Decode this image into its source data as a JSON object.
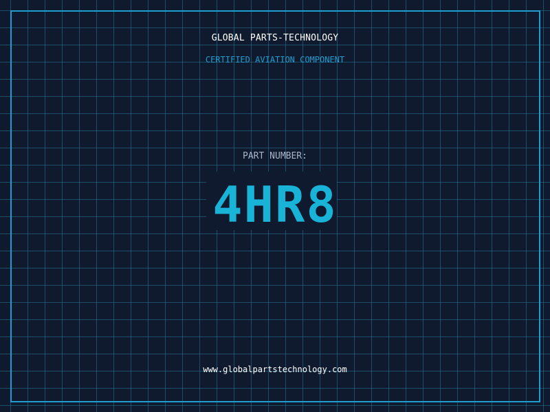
{
  "header": {
    "company_name": "GLOBAL PARTS-TECHNOLOGY",
    "tagline": "CERTIFIED AVIATION COMPONENT"
  },
  "part": {
    "label": "PART NUMBER:",
    "number": "4HR8"
  },
  "footer": {
    "website": "www.globalpartstechnology.com"
  },
  "colors": {
    "background": "#101a2e",
    "accent": "#1e9fd0",
    "part_number": "#19b3d8",
    "grid": "#28788f"
  }
}
